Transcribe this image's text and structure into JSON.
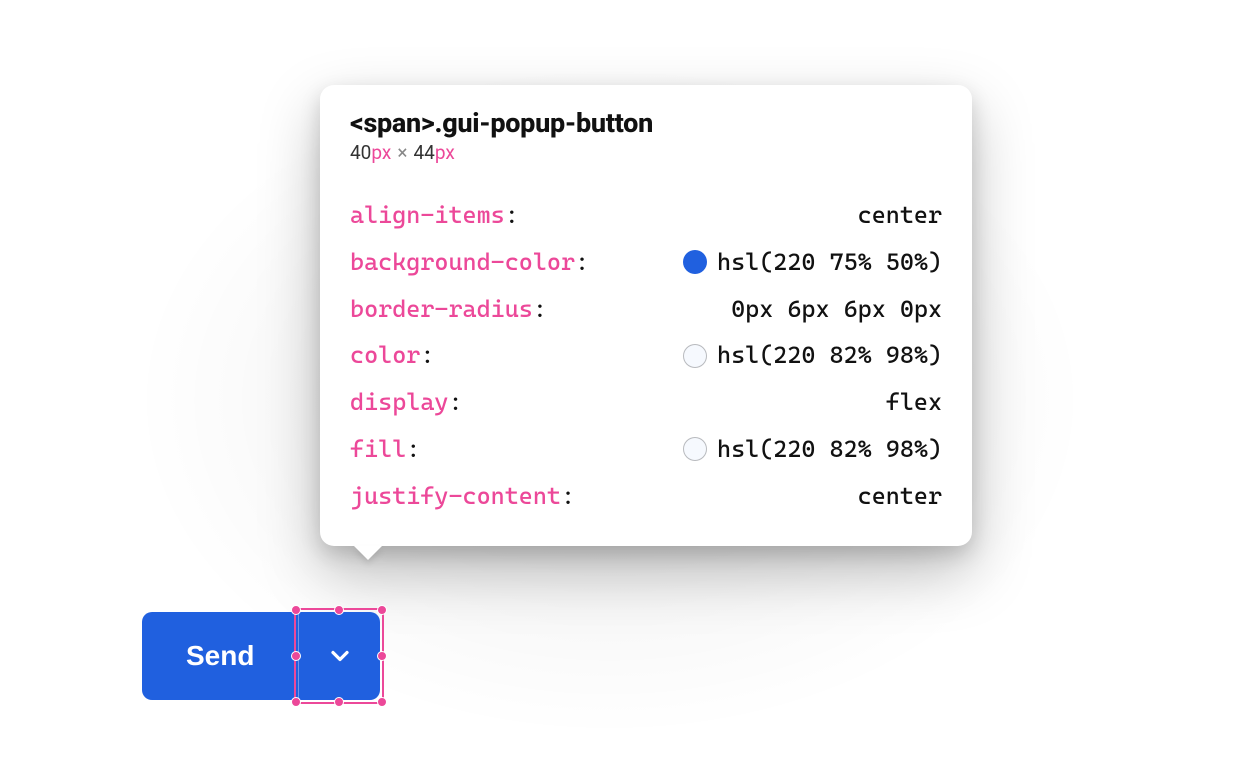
{
  "tooltip": {
    "element_tag": "<span>",
    "element_class": ".gui-popup-button",
    "dimensions": {
      "w": "40",
      "h": "44",
      "unit": "px"
    },
    "properties": [
      {
        "name": "align-items",
        "value": "center",
        "swatch": null
      },
      {
        "name": "background-color",
        "value": "hsl(220 75% 50%)",
        "swatch": "blue"
      },
      {
        "name": "border-radius",
        "value": "0px 6px 6px 0px",
        "swatch": null
      },
      {
        "name": "color",
        "value": "hsl(220 82% 98%)",
        "swatch": "light"
      },
      {
        "name": "display",
        "value": "flex",
        "swatch": null
      },
      {
        "name": "fill",
        "value": "hsl(220 82% 98%)",
        "swatch": "light"
      },
      {
        "name": "justify-content",
        "value": "center",
        "swatch": null
      }
    ]
  },
  "split_button": {
    "primary_label": "Send"
  },
  "colors": {
    "accent_blue": "hsl(220 75% 50%)",
    "near_white": "hsl(220 82% 98%)",
    "pink": "#ec4899"
  }
}
